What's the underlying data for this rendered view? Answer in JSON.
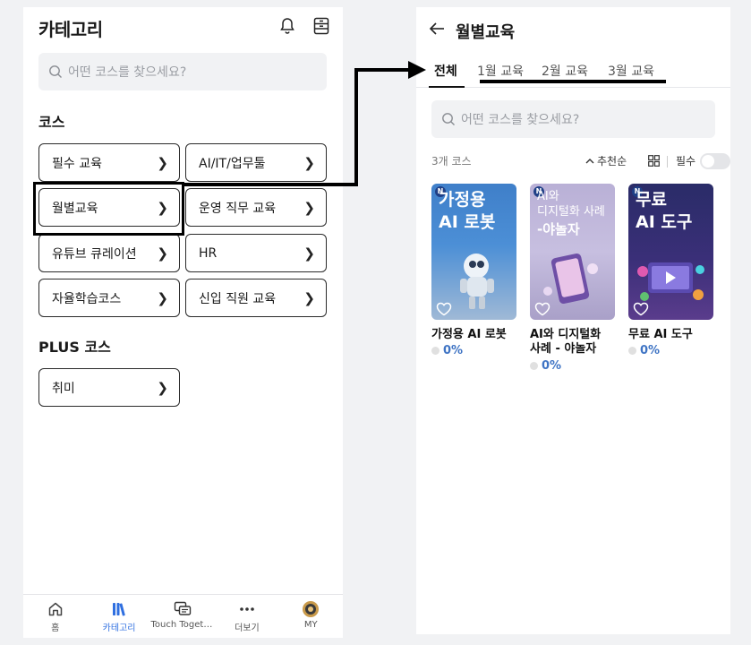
{
  "left": {
    "title": "카테고리",
    "search_placeholder": "어떤 코스를 찾으세요?",
    "section_course": "코스",
    "courses": [
      {
        "label": "필수 교육"
      },
      {
        "label": "AI/IT/업무툴"
      },
      {
        "label": "월별교육"
      },
      {
        "label": "운영 직무 교육"
      },
      {
        "label": "유튜브 큐레이션"
      },
      {
        "label": "HR"
      },
      {
        "label": "자율학습코스"
      },
      {
        "label": "신입 직원 교육"
      }
    ],
    "section_plus": "PLUS 코스",
    "plus_courses": [
      {
        "label": "취미"
      }
    ],
    "nav": [
      {
        "label": "홈",
        "icon": "home-icon"
      },
      {
        "label": "카테고리",
        "icon": "library-icon"
      },
      {
        "label": "Touch Togeth...",
        "icon": "chat-icon"
      },
      {
        "label": "더보기",
        "icon": "more-icon"
      },
      {
        "label": "MY",
        "icon": "profile-icon"
      }
    ]
  },
  "right": {
    "title": "월별교육",
    "tabs": [
      {
        "label": "전체"
      },
      {
        "label": "1월 교육"
      },
      {
        "label": "2월 교육"
      },
      {
        "label": "3월 교육"
      }
    ],
    "search_placeholder": "어떤 코스를 찾으세요?",
    "count_label": "3개 코스",
    "sort_label": "추천순",
    "required_label": "필수",
    "cards": [
      {
        "thumb_line1": "가정용",
        "thumb_line2": "AI 로봇",
        "title": "가정용 AI 로봇",
        "progress": "0%"
      },
      {
        "thumb_line1": "AI와",
        "thumb_line2": "디지털화 사례",
        "thumb_line3": "-야놀자",
        "title": "AI와 디지털화 사례 - 야놀자",
        "progress": "0%"
      },
      {
        "thumb_line1": "무료",
        "thumb_line2": "AI 도구",
        "title": "무료 AI 도구",
        "progress": "0%"
      }
    ],
    "badge": "N"
  },
  "colors": {
    "accent": "#2f6fe0",
    "progress": "#3f74c4",
    "card1": "#3a6bb0",
    "card2": "#b7acd0",
    "card3": "#2b2d63"
  }
}
